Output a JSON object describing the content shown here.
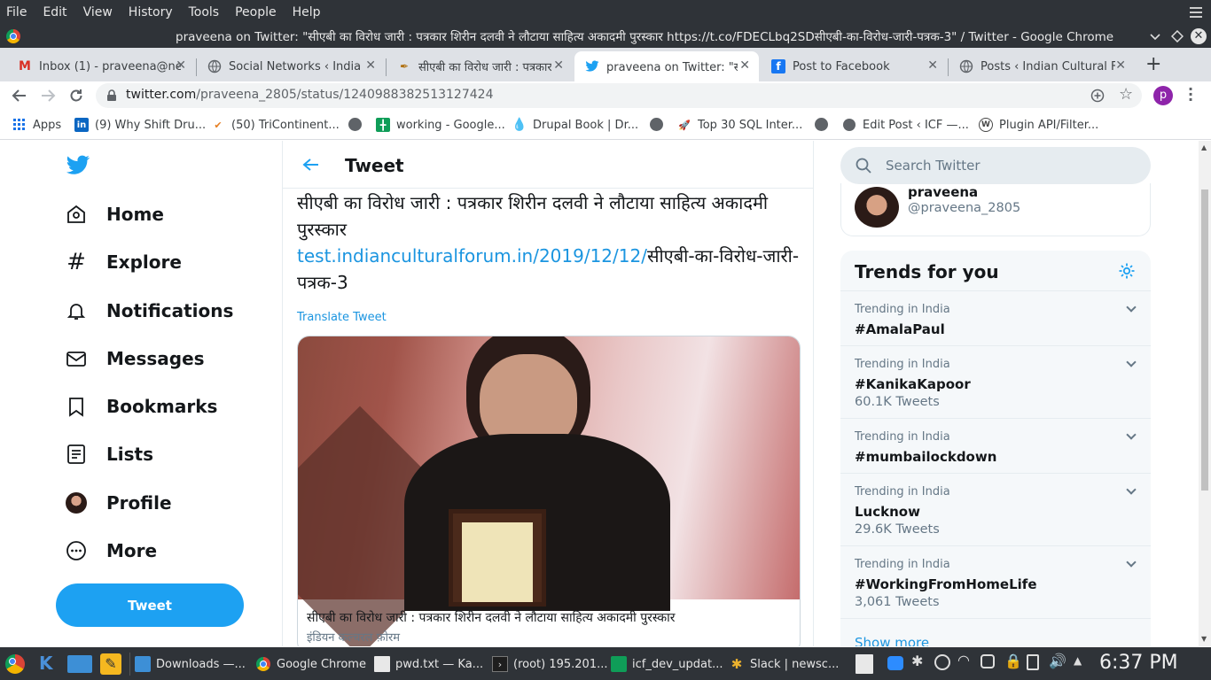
{
  "menubar": {
    "items": [
      "File",
      "Edit",
      "View",
      "History",
      "Tools",
      "People",
      "Help"
    ]
  },
  "window": {
    "title": "praveena on Twitter: \"सीएबी का विरोध जारी : पत्रकार शिरीन दलवी ने लौटाया साहित्य अकादमी पुरस्कार https://t.co/FDECLbq2SDसीएबी-का-विरोध-जारी-पत्रक-3\" / Twitter - Google Chrome"
  },
  "tabs": [
    {
      "label": "Inbox (1) - praveena@ne",
      "icon": "gmail-icon"
    },
    {
      "label": "Social Networks ‹ Indian",
      "icon": "globe-icon"
    },
    {
      "label": "सीएबी का विरोध जारी : पत्रकार",
      "icon": "pen-icon"
    },
    {
      "label": "praveena on Twitter: \"सीए",
      "icon": "twitter-icon"
    },
    {
      "label": "Post to Facebook",
      "icon": "facebook-icon"
    },
    {
      "label": "Posts ‹ Indian Cultural Fo",
      "icon": "globe-icon"
    }
  ],
  "address": {
    "host": "twitter.com",
    "path": "/praveena_2805/status/1240988382513127424",
    "profile_letter": "p"
  },
  "bookmarks": [
    {
      "label": "Apps"
    },
    {
      "label": "(9) Why Shift Dru..."
    },
    {
      "label": "(50) TriContinent..."
    },
    {
      "label": "working - Google..."
    },
    {
      "label": "Drupal Book | Dr..."
    },
    {
      "label": "Top 30 SQL Inter..."
    },
    {
      "label": "Edit Post ‹ ICF —..."
    },
    {
      "label": "Plugin API/Filter..."
    }
  ],
  "nav": {
    "items": [
      "Home",
      "Explore",
      "Notifications",
      "Messages",
      "Bookmarks",
      "Lists",
      "Profile",
      "More"
    ],
    "tweet_button": "Tweet"
  },
  "tweet": {
    "header": "Tweet",
    "text_part1": "सीएबी का विरोध जारी : पत्रकार शिरीन दलवी ने लौटाया साहित्य अकादमी पुरस्कार",
    "link": "test.indianculturalforum.in/2019/12/12/",
    "text_part2": "सीएबी-का-विरोध-जारी-पत्रक-3",
    "translate": "Translate Tweet",
    "card_title": "सीएबी का विरोध जारी : पत्रकार शिरीन दलवी ने लौटाया साहित्य अकादमी पुरस्कार",
    "card_source": "इंडियन कल्चरल फ़ोरम"
  },
  "sidebar": {
    "search_placeholder": "Search Twitter",
    "profile_name": "praveena",
    "profile_handle": "@praveena_2805",
    "trends_title": "Trends for you",
    "trends": [
      {
        "context": "Trending in India",
        "name": "#AmalaPaul",
        "count": ""
      },
      {
        "context": "Trending in India",
        "name": "#KanikaKapoor",
        "count": "60.1K Tweets"
      },
      {
        "context": "Trending in India",
        "name": "#mumbailockdown",
        "count": ""
      },
      {
        "context": "Trending in India",
        "name": "Lucknow",
        "count": "29.6K Tweets"
      },
      {
        "context": "Trending in India",
        "name": "#WorkingFromHomeLife",
        "count": "3,061 Tweets"
      }
    ],
    "show_more": "Show more"
  },
  "taskbar": {
    "items": [
      {
        "label": "Downloads —..."
      },
      {
        "label": "Google Chrome"
      },
      {
        "label": "pwd.txt — Ka..."
      },
      {
        "label": "(root) 195.201..."
      },
      {
        "label": "icf_dev_updat..."
      },
      {
        "label": "Slack | newsc..."
      }
    ],
    "clock": "6:37 PM"
  },
  "colors": {
    "twitter_blue": "#1da1f2",
    "link_blue": "#1b95e0",
    "chrome_dark": "#2f3338"
  }
}
